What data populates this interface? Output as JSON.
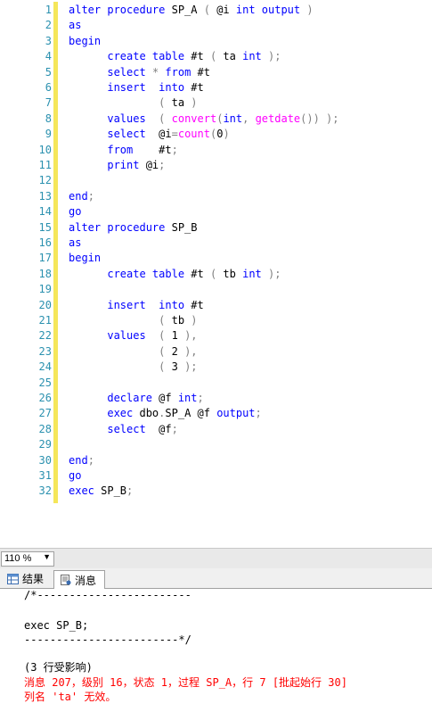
{
  "editor": {
    "line_numbers": [
      "1",
      "2",
      "3",
      "4",
      "5",
      "6",
      "7",
      "8",
      "9",
      "10",
      "11",
      "12",
      "13",
      "14",
      "15",
      "16",
      "17",
      "18",
      "19",
      "20",
      "21",
      "22",
      "23",
      "24",
      "25",
      "26",
      "27",
      "28",
      "29",
      "30",
      "31",
      "32"
    ],
    "lines": [
      [
        {
          "t": "alter procedure",
          "c": "kw"
        },
        {
          "t": " SP_A ",
          "c": "id"
        },
        {
          "t": "(",
          "c": "op"
        },
        {
          "t": " @i ",
          "c": "id"
        },
        {
          "t": "int output",
          "c": "kw"
        },
        {
          "t": " )",
          "c": "op"
        }
      ],
      [
        {
          "t": "as",
          "c": "kw"
        }
      ],
      [
        {
          "t": "begin",
          "c": "kw"
        }
      ],
      [
        {
          "t": "      create table",
          "c": "kw"
        },
        {
          "t": " #t ",
          "c": "id"
        },
        {
          "t": "(",
          "c": "op"
        },
        {
          "t": " ta ",
          "c": "id"
        },
        {
          "t": "int",
          "c": "kw"
        },
        {
          "t": " );",
          "c": "op"
        }
      ],
      [
        {
          "t": "      select",
          "c": "kw"
        },
        {
          "t": " ",
          "c": "id"
        },
        {
          "t": "*",
          "c": "op"
        },
        {
          "t": " ",
          "c": "id"
        },
        {
          "t": "from",
          "c": "kw"
        },
        {
          "t": " #t",
          "c": "id"
        }
      ],
      [
        {
          "t": "      insert",
          "c": "kw"
        },
        {
          "t": "  ",
          "c": "id"
        },
        {
          "t": "into",
          "c": "kw"
        },
        {
          "t": " #t",
          "c": "id"
        }
      ],
      [
        {
          "t": "              ",
          "c": "id"
        },
        {
          "t": "(",
          "c": "op"
        },
        {
          "t": " ta ",
          "c": "id"
        },
        {
          "t": ")",
          "c": "op"
        }
      ],
      [
        {
          "t": "      values",
          "c": "kw"
        },
        {
          "t": "  ",
          "c": "id"
        },
        {
          "t": "(",
          "c": "op"
        },
        {
          "t": " ",
          "c": "id"
        },
        {
          "t": "convert",
          "c": "fn"
        },
        {
          "t": "(",
          "c": "op"
        },
        {
          "t": "int",
          "c": "kw"
        },
        {
          "t": ", ",
          "c": "op"
        },
        {
          "t": "getdate",
          "c": "fn"
        },
        {
          "t": "()) );",
          "c": "op"
        }
      ],
      [
        {
          "t": "      select",
          "c": "kw"
        },
        {
          "t": "  @i",
          "c": "id"
        },
        {
          "t": "=",
          "c": "op"
        },
        {
          "t": "count",
          "c": "fn"
        },
        {
          "t": "(",
          "c": "op"
        },
        {
          "t": "0",
          "c": "id"
        },
        {
          "t": ")",
          "c": "op"
        }
      ],
      [
        {
          "t": "      from",
          "c": "kw"
        },
        {
          "t": "    #t",
          "c": "id"
        },
        {
          "t": ";",
          "c": "op"
        }
      ],
      [
        {
          "t": "      print",
          "c": "kw"
        },
        {
          "t": " @i",
          "c": "id"
        },
        {
          "t": ";",
          "c": "op"
        }
      ],
      [],
      [
        {
          "t": "end",
          "c": "kw"
        },
        {
          "t": ";",
          "c": "op"
        }
      ],
      [
        {
          "t": "go",
          "c": "kw"
        }
      ],
      [
        {
          "t": "alter procedure",
          "c": "kw"
        },
        {
          "t": " SP_B",
          "c": "id"
        }
      ],
      [
        {
          "t": "as",
          "c": "kw"
        }
      ],
      [
        {
          "t": "begin",
          "c": "kw"
        }
      ],
      [
        {
          "t": "      create table",
          "c": "kw"
        },
        {
          "t": " #t ",
          "c": "id"
        },
        {
          "t": "(",
          "c": "op"
        },
        {
          "t": " tb ",
          "c": "id"
        },
        {
          "t": "int",
          "c": "kw"
        },
        {
          "t": " );",
          "c": "op"
        }
      ],
      [],
      [
        {
          "t": "      insert",
          "c": "kw"
        },
        {
          "t": "  ",
          "c": "id"
        },
        {
          "t": "into",
          "c": "kw"
        },
        {
          "t": " #t",
          "c": "id"
        }
      ],
      [
        {
          "t": "              ",
          "c": "id"
        },
        {
          "t": "(",
          "c": "op"
        },
        {
          "t": " tb ",
          "c": "id"
        },
        {
          "t": ")",
          "c": "op"
        }
      ],
      [
        {
          "t": "      values",
          "c": "kw"
        },
        {
          "t": "  ",
          "c": "id"
        },
        {
          "t": "(",
          "c": "op"
        },
        {
          "t": " 1 ",
          "c": "id"
        },
        {
          "t": "),",
          "c": "op"
        }
      ],
      [
        {
          "t": "              ",
          "c": "id"
        },
        {
          "t": "(",
          "c": "op"
        },
        {
          "t": " 2 ",
          "c": "id"
        },
        {
          "t": "),",
          "c": "op"
        }
      ],
      [
        {
          "t": "              ",
          "c": "id"
        },
        {
          "t": "(",
          "c": "op"
        },
        {
          "t": " 3 ",
          "c": "id"
        },
        {
          "t": ");",
          "c": "op"
        }
      ],
      [],
      [
        {
          "t": "      declare",
          "c": "kw"
        },
        {
          "t": " @f ",
          "c": "id"
        },
        {
          "t": "int",
          "c": "kw"
        },
        {
          "t": ";",
          "c": "op"
        }
      ],
      [
        {
          "t": "      exec",
          "c": "kw"
        },
        {
          "t": " dbo",
          "c": "id"
        },
        {
          "t": ".",
          "c": "op"
        },
        {
          "t": "SP_A @f ",
          "c": "id"
        },
        {
          "t": "output",
          "c": "kw"
        },
        {
          "t": ";",
          "c": "op"
        }
      ],
      [
        {
          "t": "      select",
          "c": "kw"
        },
        {
          "t": "  @f",
          "c": "id"
        },
        {
          "t": ";",
          "c": "op"
        }
      ],
      [],
      [
        {
          "t": "end",
          "c": "kw"
        },
        {
          "t": ";",
          "c": "op"
        }
      ],
      [
        {
          "t": "go",
          "c": "kw"
        }
      ],
      [
        {
          "t": "exec",
          "c": "kw"
        },
        {
          "t": " SP_B",
          "c": "id"
        },
        {
          "t": ";",
          "c": "op"
        }
      ]
    ]
  },
  "zoom": {
    "value": "110 %"
  },
  "tabs": {
    "results": "结果",
    "messages": "消息"
  },
  "messages": [
    {
      "text": "/*------------------------",
      "color": "black"
    },
    {
      "text": "",
      "color": "black"
    },
    {
      "text": "exec SP_B;",
      "color": "black"
    },
    {
      "text": "------------------------*/",
      "color": "black"
    },
    {
      "text": "",
      "color": "black"
    },
    {
      "text": "(3 行受影响)",
      "color": "black"
    },
    {
      "text": "消息 207，级别 16，状态 1，过程 SP_A，行 7 [批起始行 30]",
      "color": "red"
    },
    {
      "text": "列名 'ta' 无效。",
      "color": "red"
    }
  ],
  "colors": {
    "keyword": "#0000ff",
    "function": "#ff00ff",
    "operator": "#808080",
    "line_number": "#2b91af",
    "change_bar": "#f5e65a",
    "error": "#ff0000"
  }
}
